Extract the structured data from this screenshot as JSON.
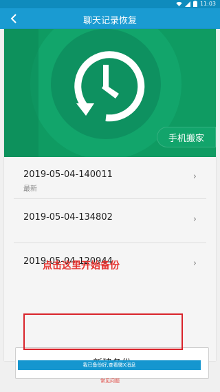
{
  "status_bar": {
    "time": "11:03",
    "icons": [
      "wifi-icon",
      "signal-icon",
      "battery-icon"
    ]
  },
  "app_bar": {
    "title": "聊天记录恢复"
  },
  "hero": {
    "tag_label": "手机搬家",
    "icon": "clock-restore-icon"
  },
  "backups": [
    {
      "date": "2019-05-04-140011",
      "sub": "最新"
    },
    {
      "date": "2019-05-04-134802",
      "sub": ""
    },
    {
      "date": "2019-05-04-120944",
      "sub": ""
    }
  ],
  "annotation": {
    "text": "点击这里开始备份"
  },
  "new_backup_button": {
    "label": "新建备份"
  },
  "footer": {
    "banner_text": "我已备份好,查看微X消息",
    "faq_text": "常见问题"
  },
  "colors": {
    "status": "#0f8bbd",
    "app_bar": "#1a9bd2",
    "hero": "#0f9b62",
    "annotation": "#e5322e"
  }
}
